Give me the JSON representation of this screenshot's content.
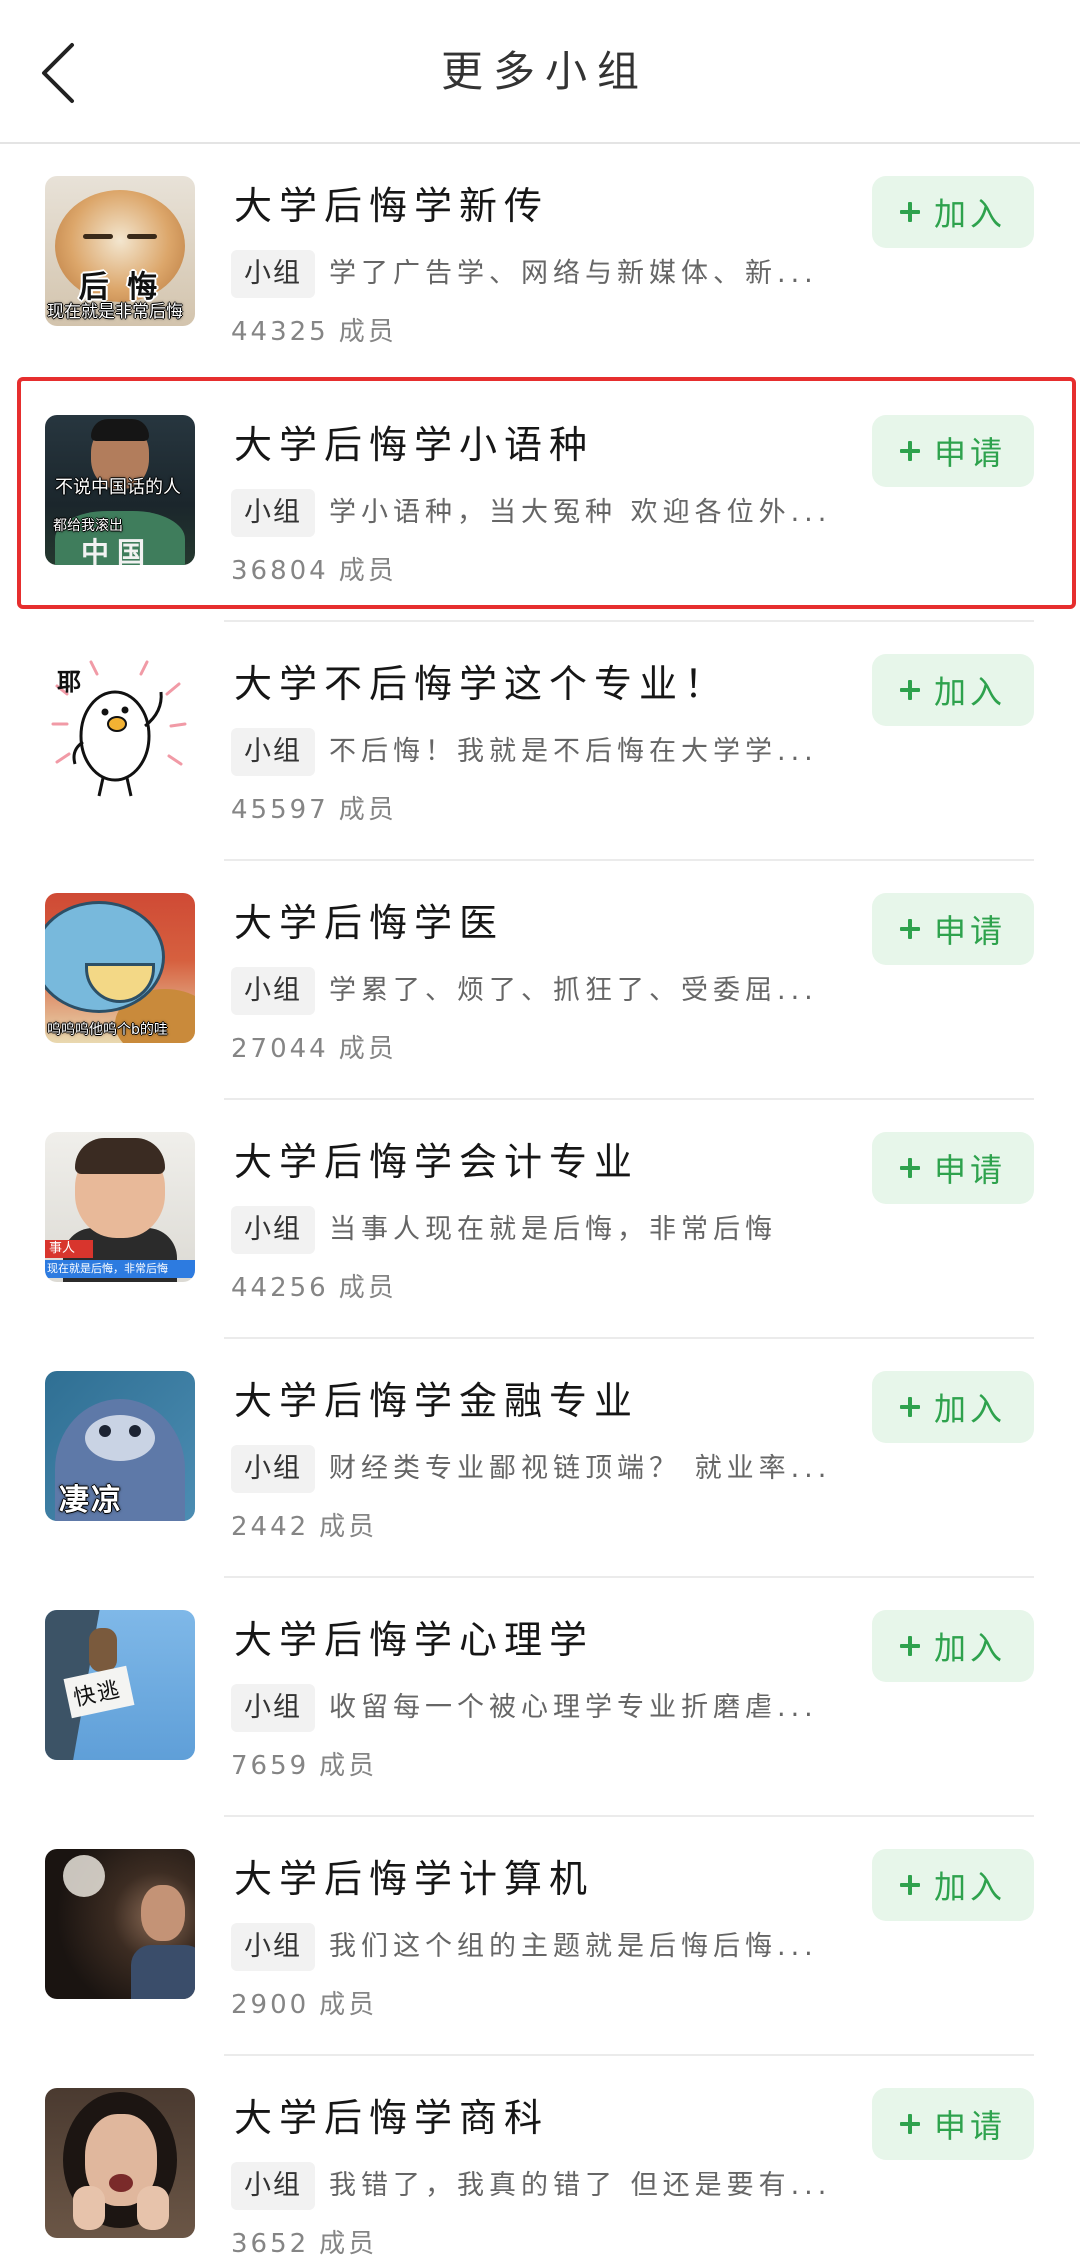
{
  "header": {
    "title": "更多小组",
    "back_icon": "chevron-left-icon"
  },
  "colors": {
    "accent": "#2ea24d",
    "button_bg": "#e7f6ea",
    "tag_bg": "#f2f2f2",
    "highlight": "#e62e2e"
  },
  "highlighted_row": 1,
  "groups": [
    {
      "name": "大学后悔学新传",
      "tag": "小组",
      "description": "学了广告学、网络与新媒体、新...",
      "member_count": "44325",
      "member_label": "成员",
      "action": "加入",
      "action_icon": "plus-icon",
      "avatar_captions": [
        "后 悔",
        "现在就是非常后悔"
      ]
    },
    {
      "name": "大学后悔学小语种",
      "tag": "小组",
      "description": "学小语种，当大冤种 欢迎各位外...",
      "member_count": "36804",
      "member_label": "成员",
      "action": "申请",
      "action_icon": "plus-icon",
      "avatar_captions": [
        "不说中国话的人",
        "都给我滚出",
        "中国"
      ]
    },
    {
      "name": "大学不后悔学这个专业！",
      "tag": "小组",
      "description": "不后悔！我就是不后悔在大学学...",
      "member_count": "45597",
      "member_label": "成员",
      "action": "加入",
      "action_icon": "plus-icon",
      "avatar_captions": [
        "耶"
      ]
    },
    {
      "name": "大学后悔学医",
      "tag": "小组",
      "description": "学累了、烦了、抓狂了、受委屈...",
      "member_count": "27044",
      "member_label": "成员",
      "action": "申请",
      "action_icon": "plus-icon",
      "avatar_captions": [
        "呜呜呜他呜个b的哇"
      ]
    },
    {
      "name": "大学后悔学会计专业",
      "tag": "小组",
      "description": "当事人现在就是后悔，非常后悔",
      "member_count": "44256",
      "member_label": "成员",
      "action": "申请",
      "action_icon": "plus-icon",
      "avatar_captions": [
        "事人",
        "现在就是后悔，非常后悔"
      ]
    },
    {
      "name": "大学后悔学金融专业",
      "tag": "小组",
      "description": "财经类专业鄙视链顶端？ 就业率...",
      "member_count": "2442",
      "member_label": "成员",
      "action": "加入",
      "action_icon": "plus-icon",
      "avatar_captions": [
        "凄凉"
      ]
    },
    {
      "name": "大学后悔学心理学",
      "tag": "小组",
      "description": "收留每一个被心理学专业折磨虐...",
      "member_count": "7659",
      "member_label": "成员",
      "action": "加入",
      "action_icon": "plus-icon",
      "avatar_captions": [
        "快逃"
      ]
    },
    {
      "name": "大学后悔学计算机",
      "tag": "小组",
      "description": "我们这个组的主题就是后悔后悔...",
      "member_count": "2900",
      "member_label": "成员",
      "action": "加入",
      "action_icon": "plus-icon",
      "avatar_captions": []
    },
    {
      "name": "大学后悔学商科",
      "tag": "小组",
      "description": "我错了，我真的错了 但还是要有...",
      "member_count": "3652",
      "member_label": "成员",
      "action": "申请",
      "action_icon": "plus-icon",
      "avatar_captions": []
    }
  ]
}
